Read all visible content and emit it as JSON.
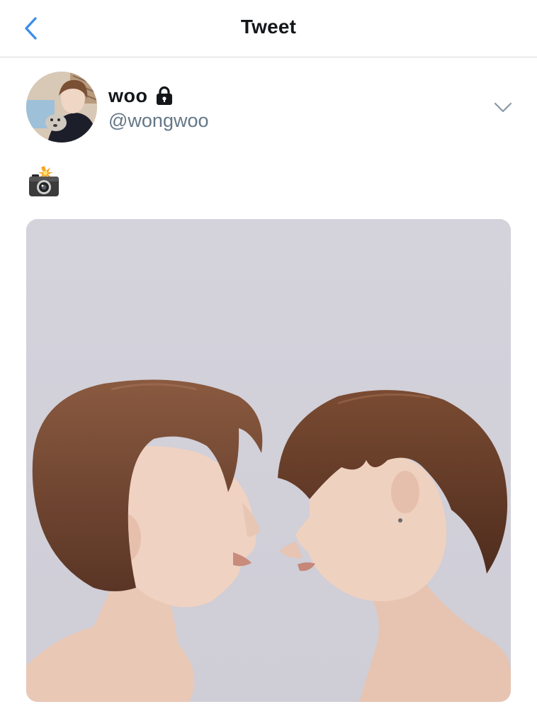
{
  "header": {
    "title": "Tweet"
  },
  "tweet": {
    "display_name": "woo",
    "handle": "@wongwoo",
    "protected": true,
    "text_icon": "camera-flash-emoji"
  },
  "colors": {
    "accent": "#1da1f2",
    "back_arrow": "#3e8ee8",
    "secondary_text": "#657786",
    "divider": "#d3d6d9",
    "media_background": "#d2d0d9"
  }
}
